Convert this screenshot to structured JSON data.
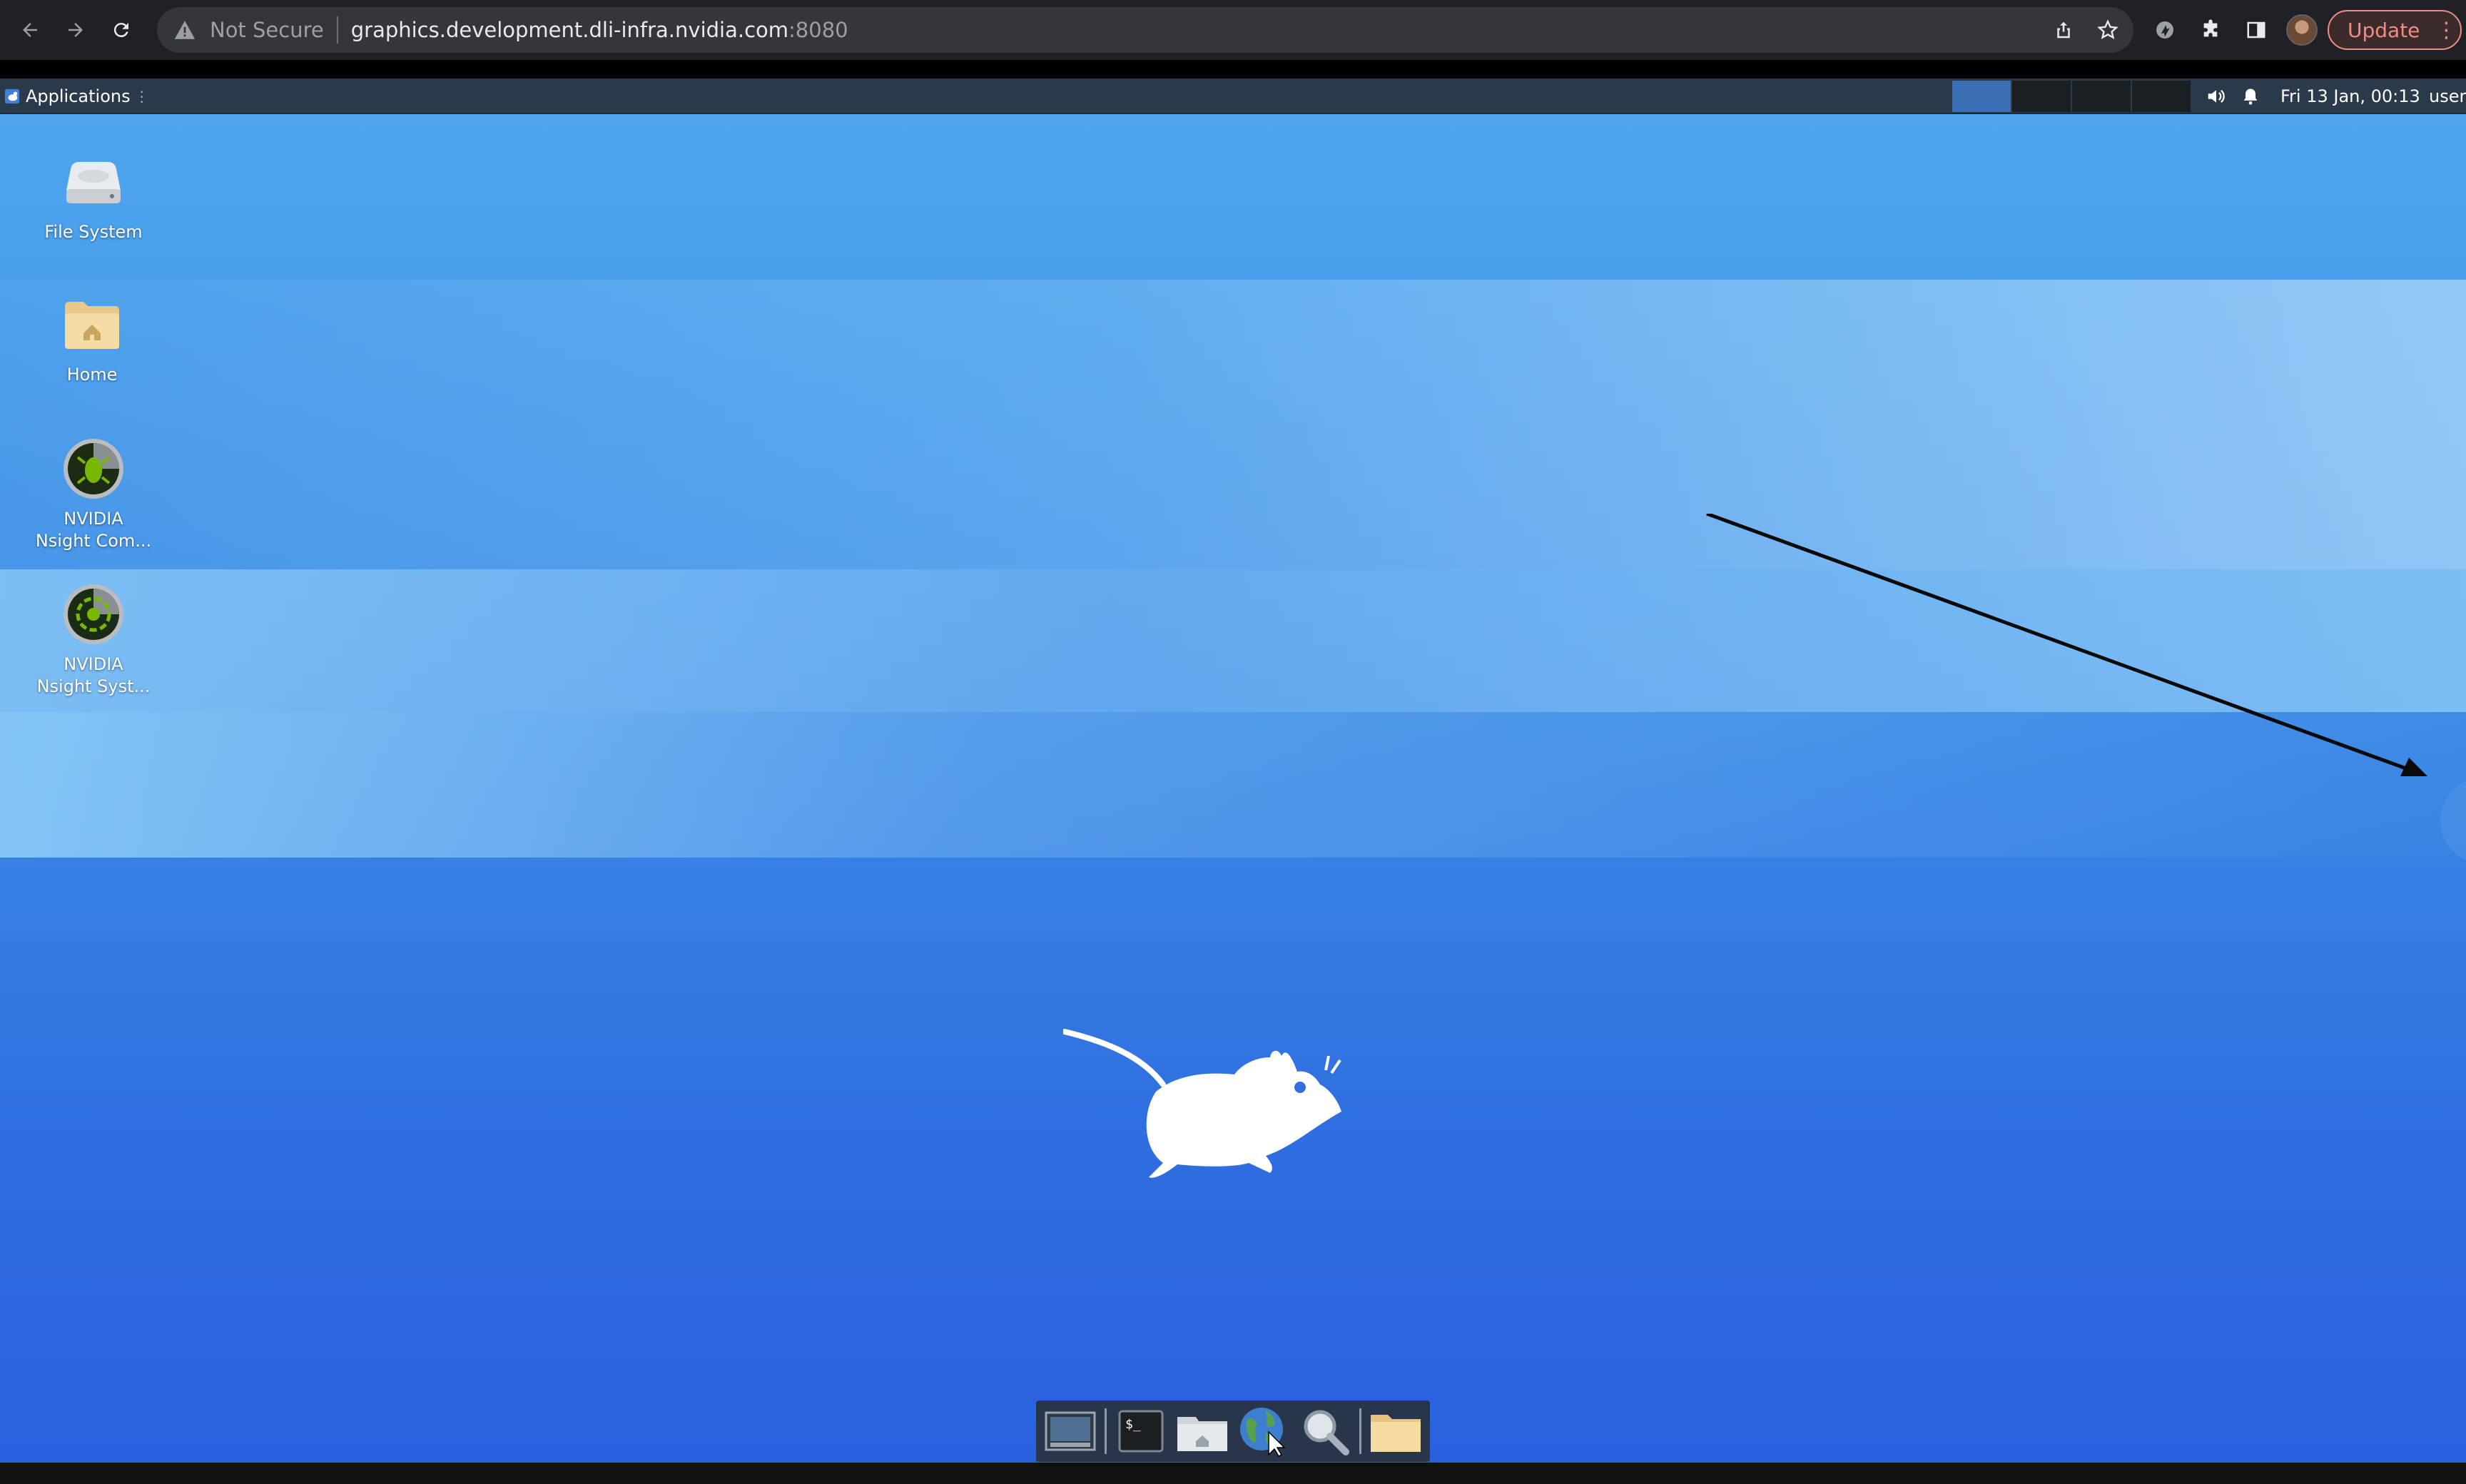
{
  "browser": {
    "security_label": "Not Secure",
    "url_host": "graphics.development.dli-infra.nvidia.com",
    "url_port": ":8080",
    "update_label": "Update",
    "nav_icons": [
      "back-icon",
      "forward-icon",
      "reload-icon"
    ],
    "toolbar_icons": [
      "share-icon",
      "bookmark-star-icon",
      "extension-icon",
      "puzzle-icon",
      "side-panel-icon",
      "profile-avatar",
      "more-menu-icon"
    ],
    "update_color": "#f28b82"
  },
  "panel": {
    "applications_label": "Applications",
    "clock": "Fri 13 Jan, 00:13",
    "user": "user",
    "workspaces": 4,
    "active_workspace": 1,
    "tray_icons": [
      "volume-icon",
      "notification-bell-icon"
    ]
  },
  "desktop": {
    "icons": [
      {
        "label_line1": "File System",
        "label_line2": "",
        "icon": "drive-icon"
      },
      {
        "label_line1": "Home",
        "label_line2": "",
        "icon": "home-folder-icon"
      },
      {
        "label_line1": "NVIDIA",
        "label_line2": "Nsight Com...",
        "icon": "nsight-compute-icon"
      },
      {
        "label_line1": "NVIDIA",
        "label_line2": "Nsight Syst...",
        "icon": "nsight-systems-icon"
      }
    ],
    "wallpaper_logo": "xfce-mouse-logo",
    "annotation": "arrow-pointing-right-edge",
    "accent": "#3f8de6"
  },
  "dock": {
    "items": [
      "show-desktop-icon",
      "terminal-icon",
      "file-manager-icon",
      "web-browser-icon",
      "app-finder-icon",
      "folder-icon"
    ]
  }
}
